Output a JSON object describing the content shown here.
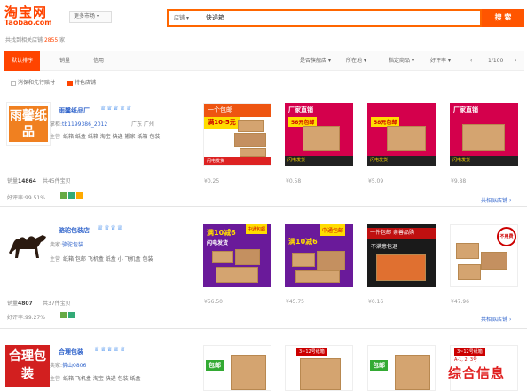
{
  "header": {
    "logo_cn": "淘宝网",
    "logo_en": "Taobao.com",
    "more_market": "更多市场",
    "found_prefix": "共找到相关店铺",
    "found_count": "2855",
    "found_suffix": "家"
  },
  "search": {
    "select_label": "店铺",
    "value": "快递箱",
    "button": "搜 索"
  },
  "sortbar": {
    "default_tab": "默认排序",
    "sales": "销量",
    "credit": "信用",
    "sub_store": "是否旗舰店",
    "location": "所在地",
    "guarantee": "指定商品",
    "rating": "好评率",
    "pagination": "1/100",
    "prev_icon": "chevron-left-icon",
    "next_icon": "chevron-right-icon"
  },
  "filters": {
    "consumer_protect": "消保和先行赔付",
    "special": "特色店铺"
  },
  "shops": [
    {
      "name": "雨馨纸品厂",
      "logo_text": "雨馨纸品",
      "crowns": "♕♕♕♕♕",
      "seller_prefix": "掌柜:",
      "seller": "tb1199386_2012",
      "location": "广东 广州",
      "main_label": "主营",
      "main": "纸箱 纸盒 纸箱 淘宝 快递 搬家 纸箱 包装",
      "sales_prefix": "销量",
      "sales": "14864",
      "products_prefix": "共",
      "products": "45件宝贝",
      "rating_prefix": "好评率:",
      "rating": "99.51%",
      "more": "共相似店铺",
      "prices": [
        "¥0.25",
        "¥0.58",
        "¥5.09",
        "¥9.88"
      ]
    },
    {
      "name": "骆驼包装店",
      "logo_text": "",
      "crowns": "♕♕♕♕",
      "seller_prefix": "卖家:",
      "seller": "骆驼包装",
      "location": "",
      "main_label": "主营",
      "main": "纸箱 包邮 飞机盒 纸盒 小 飞机盒 包装",
      "sales_prefix": "销量",
      "sales": "4807",
      "products_prefix": "共",
      "products": "37件宝贝",
      "rating_prefix": "好评率:",
      "rating": "99.27%",
      "more": "共相似店铺",
      "prices": [
        "¥56.50",
        "¥45.75",
        "¥0.16",
        "¥47.96"
      ]
    },
    {
      "name": "合理包装",
      "logo_text": "合理包装",
      "crowns": "♕♕♕♕♕",
      "seller_prefix": "卖家:",
      "seller": "佛山0806",
      "location": "",
      "main_label": "主营",
      "main": "纸箱 飞机盒 淘宝 快递 包装 纸盒",
      "sales_prefix": "",
      "sales": "",
      "products_prefix": "",
      "products": "",
      "rating_prefix": "",
      "rating": "",
      "more": "",
      "prices": [
        "",
        "",
        "",
        ""
      ]
    }
  ],
  "promo": {
    "r1p1_top": "一个包邮",
    "r1p1_mid": "满10-5元",
    "r1p2_top": "厂家直销",
    "r1p2_mid": "56元包邮",
    "r1p3_mid": "58元包邮",
    "r1p4_top": "厂家直销",
    "r1_bottom": "闪电发货",
    "r2p1_top": "满10减6",
    "r2p1_tag": "中通包邮",
    "r2p1_mid": "闪电发货",
    "r2p2_tag": "中通包邮",
    "r2p2_mid": "满10减6",
    "r2p3_top": "一件包邮",
    "r2p3_mid": "亲善品购",
    "r2p3_bot": "不满意包退",
    "r2p4_top": "不用费",
    "r3p1_top": "包邮",
    "r3p2_top": "3~12号纸箱",
    "r3p3_top": "包邮",
    "r3p4_top": "3~12号纸箱",
    "r3p4_bot": "A-1, 2, 3号"
  },
  "watermark": "综合信息",
  "colors": {
    "accent": "#ff4400",
    "link": "#3366cc",
    "crown": "#1a73e8"
  }
}
